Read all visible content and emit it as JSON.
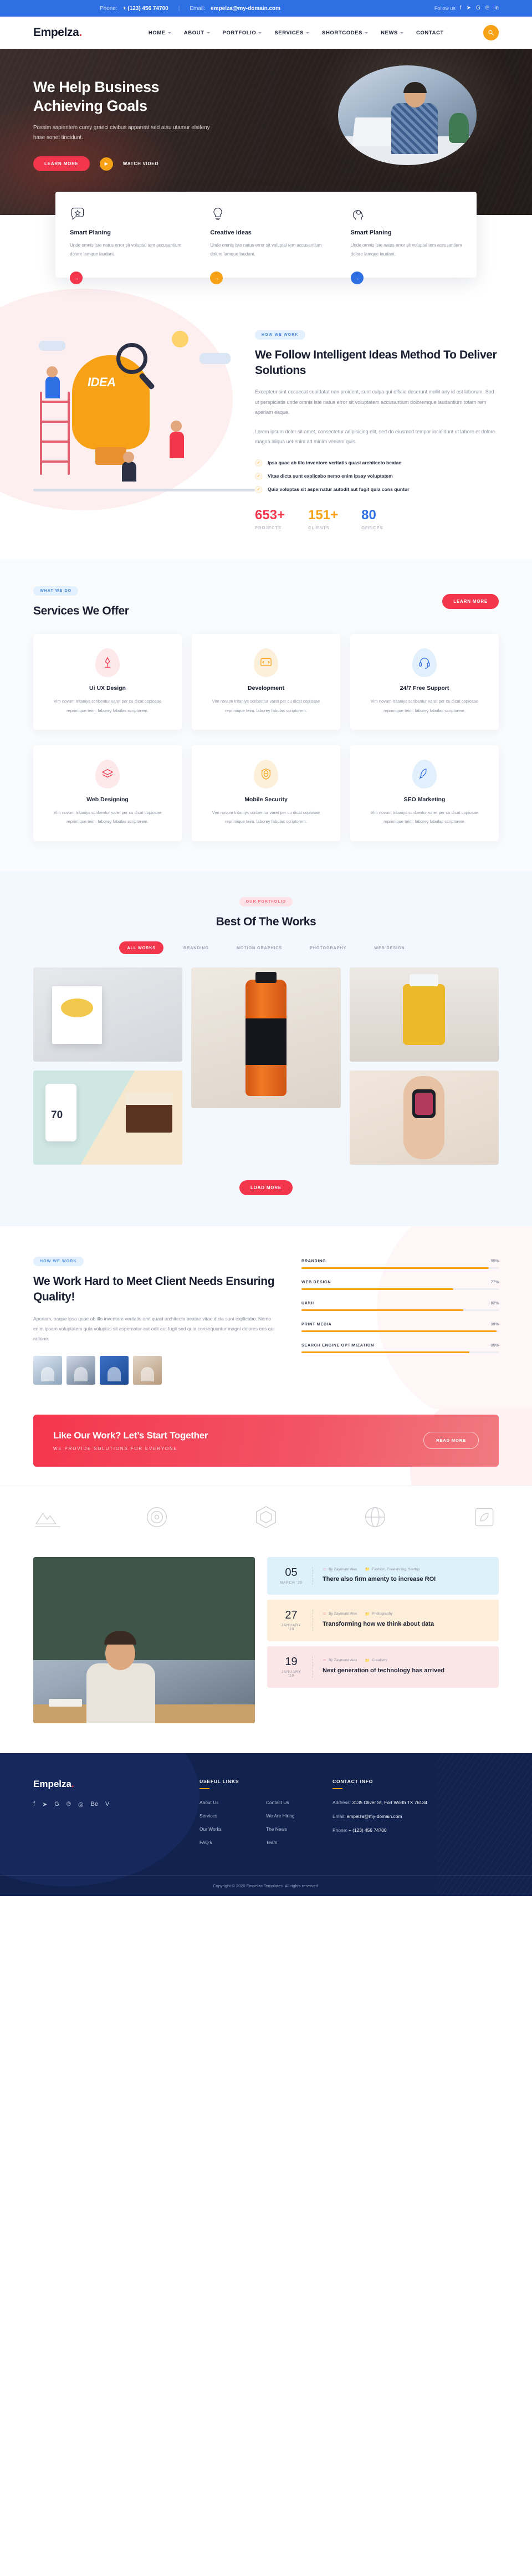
{
  "topbar": {
    "phone_label": "Phone:",
    "phone": "+ (123) 456 74700",
    "email_label": "Email:",
    "email": "empelza@my-domain.com",
    "follow_label": "Follow us",
    "socials": [
      "facebook-icon",
      "twitter-icon",
      "google-plus-icon",
      "pinterest-icon",
      "linkedin-icon"
    ]
  },
  "nav": {
    "logo": "Empelza",
    "logo_dot": ".",
    "items": [
      {
        "label": "HOME",
        "caret": true
      },
      {
        "label": "ABOUT",
        "caret": true
      },
      {
        "label": "PORTFOLIO",
        "caret": true
      },
      {
        "label": "SERVICES",
        "caret": true
      },
      {
        "label": "SHORTCODES",
        "caret": true
      },
      {
        "label": "NEWS",
        "caret": true
      },
      {
        "label": "CONTACT",
        "caret": false
      }
    ],
    "search_icon": "⌕"
  },
  "hero": {
    "title_line1": "We Help Business",
    "title_line2": "Achieving Goals",
    "subtitle": "Possim sapientem cumy graeci civibus appareat sed atsu utamur elsifeny hase sonet tincidunt.",
    "primary_btn": "LEARN MORE",
    "video_btn": "WATCH VIDEO",
    "play_icon": "▶"
  },
  "features": [
    {
      "icon": "chat-star-icon",
      "title": "Smart Planing",
      "text": "Unde omnis iste natus error sit voluptal tem accusantium dolore lamque laudant.",
      "arrow_color": "#f4364c",
      "arrow_icon": "→"
    },
    {
      "icon": "lightbulb-icon",
      "title": "Creative Ideas",
      "text": "Unde omnis iste natus error sit voluptal tem accusantium dolore lamque laudant.",
      "arrow_color": "#f7a116",
      "arrow_icon": "→"
    },
    {
      "icon": "head-gear-icon",
      "title": "Smart Planing",
      "text": "Unde omnis iste natus error sit voluptal tem accusantium dolore lamque laudant.",
      "arrow_color": "#2f6fe4",
      "arrow_icon": "→"
    }
  ],
  "how_we_work": {
    "pill": "HOW WE WORK",
    "title": "We Follow Intelligent Ideas Method To Deliver Solutions",
    "para1": "Excepteur sint occaecat cupidatat non proident, sunt culpa qui officia deserunt mollit any id est laborum. Sed ut perspiciatis unde omnis iste natus error sit voluptatem accusantium doloremque laudantium totam rem aperiam eaque.",
    "para2": "Lorem ipsum dolor sit amet, consectetur adipisicing elit, sed do eiusmod tempor incididunt ut labore et dolore magna aliqua uet enim ad minim veniam quis.",
    "checks": [
      "Ipsa quae ab illo inventore veritatis quasi architecto beatae",
      "Vitae dicta sunt explicabo nemo enim ipsay voluptatem",
      "Quia voluptas sit aspernatur autodit aut fugit quia cons quntur"
    ],
    "check_icon": "✓",
    "illustration_text": "IDEA",
    "counters": [
      {
        "value": "653+",
        "label": "PROJECTS",
        "color": "#f4364c"
      },
      {
        "value": "151+",
        "label": "CLIENTS",
        "color": "#f7a116"
      },
      {
        "value": "80",
        "label": "OFFICES",
        "color": "#2f6fe4"
      }
    ]
  },
  "services": {
    "pill": "WHAT WE DO",
    "title": "Services We Offer",
    "cta": "LEARN MORE",
    "cards": [
      {
        "icon": "pen-tool-icon",
        "title": "Ui UX Design",
        "text": "Vim novum tritaniys scribentur varet per cu dicat copiosae reprimique teim. laborey fabulas scriptorem.",
        "tint": "b-red",
        "stroke": "#f4364c"
      },
      {
        "icon": "code-icon",
        "title": "Development",
        "text": "Vim novum tritaniys scribentur varet per cu dicat copiosae reprimique teim. laborey fabulas scriptorem.",
        "tint": "b-orange",
        "stroke": "#f7a116"
      },
      {
        "icon": "headset-icon",
        "title": "24/7 Free Support",
        "text": "Vim novum tritaniys scribentur varet per cu dicat copiosae reprimique teim. laborey fabulas scriptorem.",
        "tint": "b-blue",
        "stroke": "#2f6fe4"
      },
      {
        "icon": "layers-icon",
        "title": "Web Designing",
        "text": "Vim novum tritaniys scribentur varet per cu dicat copiosae reprimique teim. laborey fabulas scriptorem.",
        "tint": "b-red",
        "stroke": "#f4364c"
      },
      {
        "icon": "shield-globe-icon",
        "title": "Mobile Security",
        "text": "Vim novum tritaniys scribentur varet per cu dicat copiosae reprimique teim. laborey fabulas scriptorem.",
        "tint": "b-orange",
        "stroke": "#f7a116"
      },
      {
        "icon": "rocket-icon",
        "title": "SEO Marketing",
        "text": "Vim novum tritaniys scribentur varet per cu dicat copiosae reprimique teim. laborey fabulas scriptorem.",
        "tint": "b-blue",
        "stroke": "#2f6fe4"
      }
    ]
  },
  "portfolio": {
    "pill": "OUR PORTFOLIO",
    "title": "Best Of The Works",
    "tabs": [
      "ALL WORKS",
      "BRANDING",
      "MOTION GRAPHICS",
      "PHOTOGRAPHY",
      "WEB DESIGN"
    ],
    "active_tab": "ALL WORKS",
    "load_more": "LOAD MORE"
  },
  "skills": {
    "pill": "HOW WE WORK",
    "title": "We Work Hard to Meet Client Needs Ensuring Quality!",
    "para": "Aperiam, eaque ipsa quae ab illo inventore veritatis emt quasi architecto beatae vitae dicta sunt explicabo. Nemo enim ipsam voluptatem quia voluptas sit aspernatur aut odit aut fugit sed quia consequuntur magni dolores eos qui ratione.",
    "bars": [
      {
        "label": "BRANDING",
        "pct": 95
      },
      {
        "label": "WEB DESIGN",
        "pct": 77
      },
      {
        "label": "UX/UI",
        "pct": 82
      },
      {
        "label": "PRINT MEDIA",
        "pct": 99
      },
      {
        "label": "SEARCH ENGINE OPTIMIZATION",
        "pct": 85
      }
    ]
  },
  "cta": {
    "title": "Like Our Work? Let’s Start Together",
    "subtitle": "WE PROVIDE SOLUTIONS FOR EVERYONE",
    "button": "READ MORE"
  },
  "clients": {
    "logos": [
      "mountain-logo",
      "circle-target-logo",
      "hexagon-logo",
      "spiral-globe-logo",
      "leaf-square-logo"
    ]
  },
  "blog": {
    "posts": [
      {
        "day": "05",
        "month": "MARCH ’20",
        "author": "By Zaymund Alex",
        "category": "Fashion, Freelancing, Startup",
        "title": "There also firm amenty to increase ROI",
        "tint": "bi-blue"
      },
      {
        "day": "27",
        "month": "JANUARY ’20",
        "author": "By Zaymund Alex",
        "category": "Photography",
        "title": "Transforming how we think about data",
        "tint": "bi-orange"
      },
      {
        "day": "19",
        "month": "JANUARY ’20",
        "author": "By Zaymund Alex",
        "category": "Creativity",
        "title": "Next generation of technology has arrived",
        "tint": "bi-pink"
      }
    ],
    "author_icon": "user-icon",
    "category_icon": "folder-icon"
  },
  "footer": {
    "logo": "Empelza",
    "logo_dot": ".",
    "socials": [
      "f",
      "✉",
      "G",
      "℗",
      "◎",
      "Be",
      "V"
    ],
    "useful_links_heading": "USEFUL LINKS",
    "links_col1": [
      "About Us",
      "Services",
      "Our Works",
      "FAQ's"
    ],
    "links_col2": [
      "Contact Us",
      "We Are Hiring",
      "The News",
      "Team"
    ],
    "contact_heading": "CONTACT INFO",
    "address_label": "Address:",
    "address": "3135 Oliver St, Fort Worth TX 76134",
    "email_label": "Email:",
    "email": "empelza@my-domain.com",
    "phone_label": "Phone:",
    "phone": "+ (123) 456 74700",
    "copyright": "Copyright © 2020 Empelza Templates. All rights reserved."
  }
}
